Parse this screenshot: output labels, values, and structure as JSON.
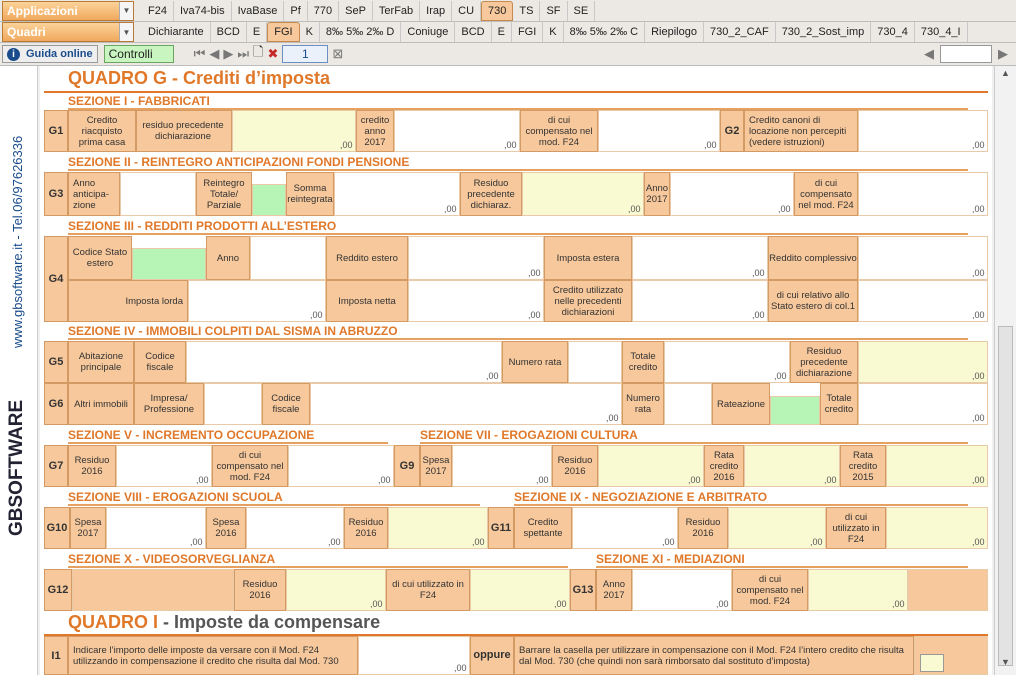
{
  "toolbar1": {
    "combo_label": "Applicazioni",
    "tabs": [
      "F24",
      "Iva74-bis",
      "IvaBase",
      "Pf",
      "770",
      "SeP",
      "TerFab",
      "Irap",
      "CU",
      "730",
      "TS",
      "SF",
      "SE"
    ]
  },
  "toolbar2": {
    "combo_label": "Quadri",
    "tabs": [
      "Dichiarante",
      "BCD",
      "E",
      "FGI",
      "K",
      "8‰ 5‰ 2‰ D",
      "Coniuge",
      "BCD",
      "E",
      "FGI",
      "K",
      "8‰ 5‰ 2‰ C",
      "Riepilogo",
      "730_2_CAF",
      "730_2_Sost_imp",
      "730_4",
      "730_4_I"
    ]
  },
  "toolbar3": {
    "guida": "Guida online",
    "controlli": "Controlli",
    "page": "1"
  },
  "sideband": {
    "line1": "www.gbsoftware.it - Tel.06/97626336",
    "logo": "GBSOFTWARE"
  },
  "doc": {
    "qg_title": "QUADRO G",
    "qg_sub": "- Crediti d’imposta",
    "s1": "SEZIONE I - FABBRICATI",
    "s2": "SEZIONE II - REINTEGRO ANTICIPAZIONI FONDI PENSIONE",
    "s3": "SEZIONE III - REDDITI PRODOTTI ALL’ESTERO",
    "s4": "SEZIONE IV - IMMOBILI COLPITI DAL SISMA IN ABRUZZO",
    "s5": "SEZIONE V - INCREMENTO OCCUPAZIONE",
    "s7": "SEZIONE VII - EROGAZIONI CULTURA",
    "s8": "SEZIONE VIII - EROGAZIONI SCUOLA",
    "s9": "SEZIONE IX - NEGOZIAZIONE E ARBITRATO",
    "s10": "SEZIONE X - VIDEOSORVEGLIANZA",
    "s11": "SEZIONE XI - MEDIAZIONI",
    "qi_title": "QUADRO I",
    "qi_sub": "- Imposte da compensare",
    "g1a": "Credito riacquisto prima casa",
    "g1b": "residuo precedente dichiarazione",
    "g1c": "credito anno 2017",
    "g1d": "di cui compensato nel mod. F24",
    "g2a": "Credito canoni di locazione non percepiti (vedere istruzioni)",
    "g3a": "Anno anticipa- zione",
    "g3b": "Reintegro Totale/ Parziale",
    "g3c": "Somma reintegrata",
    "g3d": "Residuo precedente dichiaraz.",
    "g3e": "Anno 2017",
    "g3f": "di cui compensato nel mod. F24",
    "g4a": "Codice Stato estero",
    "g4b": "Anno",
    "g4c": "Reddito estero",
    "g4d": "Imposta estera",
    "g4e": "Reddito complessivo",
    "g4f": "Imposta lorda",
    "g4g": "Imposta netta",
    "g4h": "Credito utilizzato nelle precedenti dichiarazioni",
    "g4i": "di cui relativo allo Stato estero di col.1",
    "g5a": "Abitazione principale",
    "g5b": "Codice fiscale",
    "g5c": "Numero rata",
    "g5d": "Totale credito",
    "g5e": "Residuo precedente dichiarazione",
    "g6a": "Altri immobili",
    "g6b": "Impresa/ Professione",
    "g6c": "Codice fiscale",
    "g6d": "Numero rata",
    "g6e": "Rateazione",
    "g6f": "Totale credito",
    "g7a": "Residuo 2016",
    "g7b": "di cui compensato nel mod. F24",
    "g9a": "Spesa 2017",
    "g9b": "Residuo 2016",
    "g9c": "Rata credito 2016",
    "g9d": "Rata credito 2015",
    "g10a": "Spesa 2017",
    "g10b": "Spesa 2016",
    "g10c": "Residuo 2016",
    "g11a": "Credito spettante",
    "g11b": "Residuo 2016",
    "g11c": "di cui utilizzato in F24",
    "g12a": "Residuo 2016",
    "g12b": "di cui utilizzato in F24",
    "g13a": "Anno 2017",
    "g13b": "di cui compensato nel mod. F24",
    "i1a": "Indicare l’importo delle imposte da versare con il Mod. F24 utilizzando in compensazione il credito che risulta dal Mod. 730",
    "i1b": "oppure",
    "i1c": "Barrare la casella per utilizzare in compensazione con il Mod. F24 l’intero credito che risulta dal Mod. 730 (che quindi non sarà rimborsato dal sostituto d’imposta)",
    "zeros": ",00",
    "rows": {
      "g1": "G1",
      "g2": "G2",
      "g3": "G3",
      "g4": "G4",
      "g5": "G5",
      "g6": "G6",
      "g7": "G7",
      "g9": "G9",
      "g10": "G10",
      "g11": "G11",
      "g12": "G12",
      "g13": "G13",
      "i1": "I1"
    }
  },
  "colors": {
    "accent": "#e0782a",
    "cell": "#f7c89b",
    "green": "#b6f5b6",
    "yellow": "#fafad2"
  }
}
